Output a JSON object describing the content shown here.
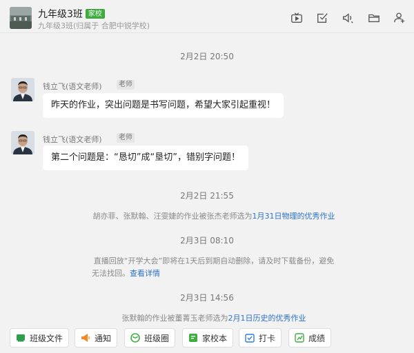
{
  "header": {
    "title": "九年级3班",
    "badge": "家校",
    "subtitle": "九年级3班(归属于 合肥中锐学校)",
    "icons": [
      "live-icon",
      "homework-check-icon",
      "announce-icon",
      "folder-icon",
      "add-member-icon"
    ]
  },
  "messages": {
    "time1": "2月2日 20:50",
    "msg1": {
      "sender": "钱立飞(语文老师)",
      "role": "老师",
      "text": "昨天的作业，突出问题是书写问题，希望大家引起重视！"
    },
    "msg2": {
      "sender": "钱立飞(语文老师)",
      "role": "老师",
      "text": "第二个问题是：“恳切”成“垦切”，错别字问题！"
    },
    "time2": "2月2日 21:55",
    "sys1": {
      "text": "胡亦菲、张默翰、汪雯婕的作业被张杰老师选为",
      "link": "1月31日物理的优秀作业"
    },
    "time3": "2月3日 08:10",
    "sys2": {
      "line1": "直播回放“开学大会”即将在1天后到期自动删除，请及时下载备份，避免",
      "line2": "无法找回。",
      "link": "查看详情"
    },
    "time4": "2月3日 14:56",
    "sys3": {
      "text": "张默翰的作业被董菁玉老师选为",
      "link": "2月1日历史的优秀作业"
    }
  },
  "quickbar": {
    "files": "班级文件",
    "notice": "通知",
    "circle": "班级圈",
    "homeschool": "家校本",
    "checkin": "打卡",
    "grades": "成绩"
  },
  "colors": {
    "badge": "#3fae3f",
    "link": "#2b72c9",
    "files_icon": "#2f9e4f",
    "notice_icon": "#f08a24",
    "circle_icon": "#3fae3f",
    "homeschool_icon": "#3fae3f",
    "checkin_icon": "#2b7de0",
    "grades_icon": "#3fae3f"
  }
}
